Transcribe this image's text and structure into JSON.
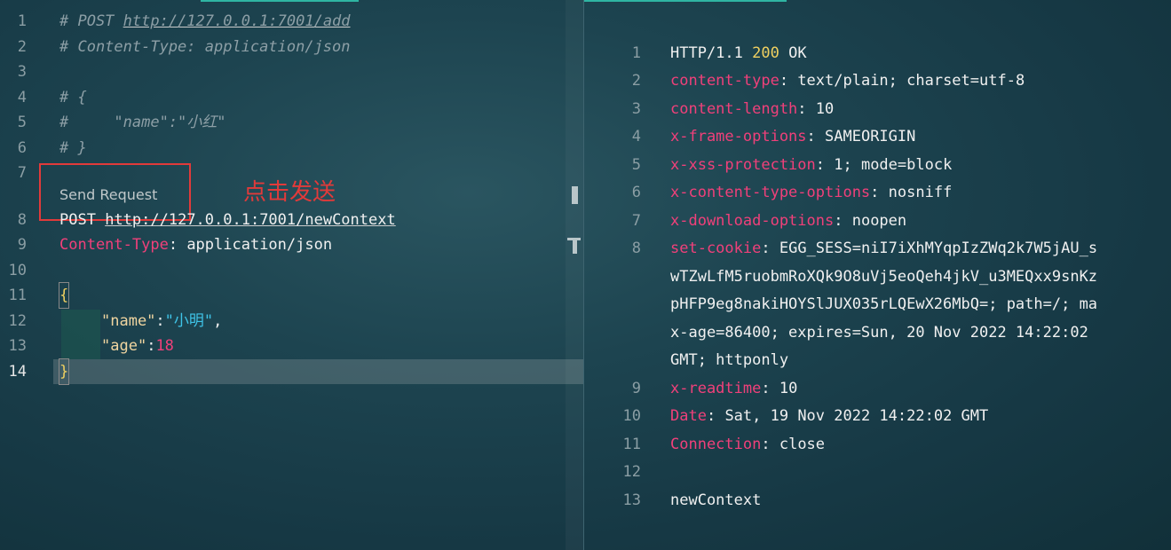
{
  "request": {
    "lines": [
      {
        "num": "1",
        "text_prefix": "# POST ",
        "url": "http://127.0.0.1:7001/add"
      },
      {
        "num": "2",
        "text": "# Content-Type: application/json"
      },
      {
        "num": "3",
        "text": ""
      },
      {
        "num": "4",
        "text": "# {"
      },
      {
        "num": "5",
        "text": "#     \"name\":\"小红\""
      },
      {
        "num": "6",
        "text": "# }"
      },
      {
        "num": "7",
        "text": ""
      },
      {
        "num": "8",
        "method": "POST",
        "url": "http://127.0.0.1:7001/newContext"
      },
      {
        "num": "9",
        "header_name": "Content-Type",
        "header_value": "application/json"
      },
      {
        "num": "10",
        "text": ""
      },
      {
        "num": "11",
        "text": "{"
      },
      {
        "num": "12",
        "key": "\"name\"",
        "value": "\"小明\"",
        "suffix": ","
      },
      {
        "num": "13",
        "key": "\"age\"",
        "value": "18"
      },
      {
        "num": "14",
        "text": "}"
      }
    ],
    "codelens": "Send Request",
    "annotation": "点击发送"
  },
  "response": {
    "status_line": {
      "proto": "HTTP/1.1",
      "code": "200",
      "text": "OK"
    },
    "headers": [
      {
        "num": "2",
        "name": "content-type",
        "value": "text/plain; charset=utf-8"
      },
      {
        "num": "3",
        "name": "content-length",
        "value": "10"
      },
      {
        "num": "4",
        "name": "x-frame-options",
        "value": "SAMEORIGIN"
      },
      {
        "num": "5",
        "name": "x-xss-protection",
        "value": "1; mode=block"
      },
      {
        "num": "6",
        "name": "x-content-type-options",
        "value": "nosniff"
      },
      {
        "num": "7",
        "name": "x-download-options",
        "value": "noopen"
      }
    ],
    "set_cookie": {
      "num": "8",
      "name": "set-cookie",
      "value_lines": [
        "EGG_SESS=niI7iXhMYqpIzZWq2k7W5jAU_s",
        "wTZwLfM5ruobmRoXQk9O8uVj5eoQeh4jkV_u3MEQxx9snKz",
        "pHFP9eg8nakiHOYSlJUX035rLQEwX26MbQ=; path=/; ma",
        "x-age=86400; expires=Sun, 20 Nov 2022 14:22:02",
        "GMT; httponly"
      ]
    },
    "headers2": [
      {
        "num": "9",
        "name": "x-readtime",
        "value": "10"
      },
      {
        "num": "10",
        "name": "Date",
        "value": "Sat, 19 Nov 2022 14:22:02 GMT"
      },
      {
        "num": "11",
        "name": "Connection",
        "value": "close"
      }
    ],
    "blank_num": "12",
    "body": {
      "num": "13",
      "text": "newContext"
    },
    "status_line_num": "1"
  }
}
